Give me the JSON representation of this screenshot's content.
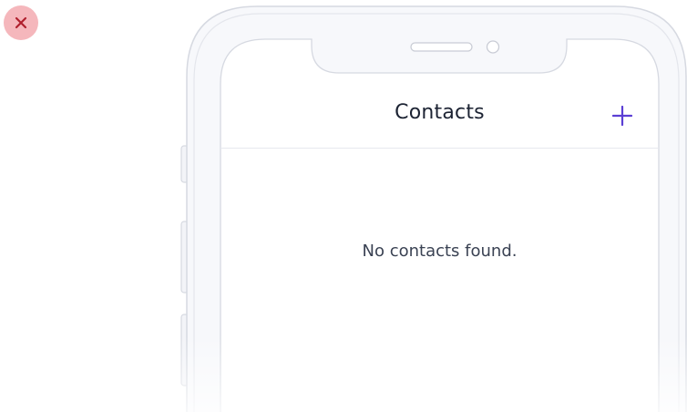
{
  "colors": {
    "accent": "#5b3fd4",
    "close_bg": "#f5b7bc",
    "close_icon": "#b0202e",
    "title_text": "#1c2333",
    "body_text": "#3a4253",
    "frame_stroke": "#d6d9e1",
    "frame_fill": "#f7f8fb"
  },
  "overlay": {
    "close_icon": "close-icon"
  },
  "screen": {
    "nav": {
      "title": "Contacts",
      "add_icon": "plus-icon"
    },
    "empty_state": {
      "message": "No contacts found."
    }
  }
}
